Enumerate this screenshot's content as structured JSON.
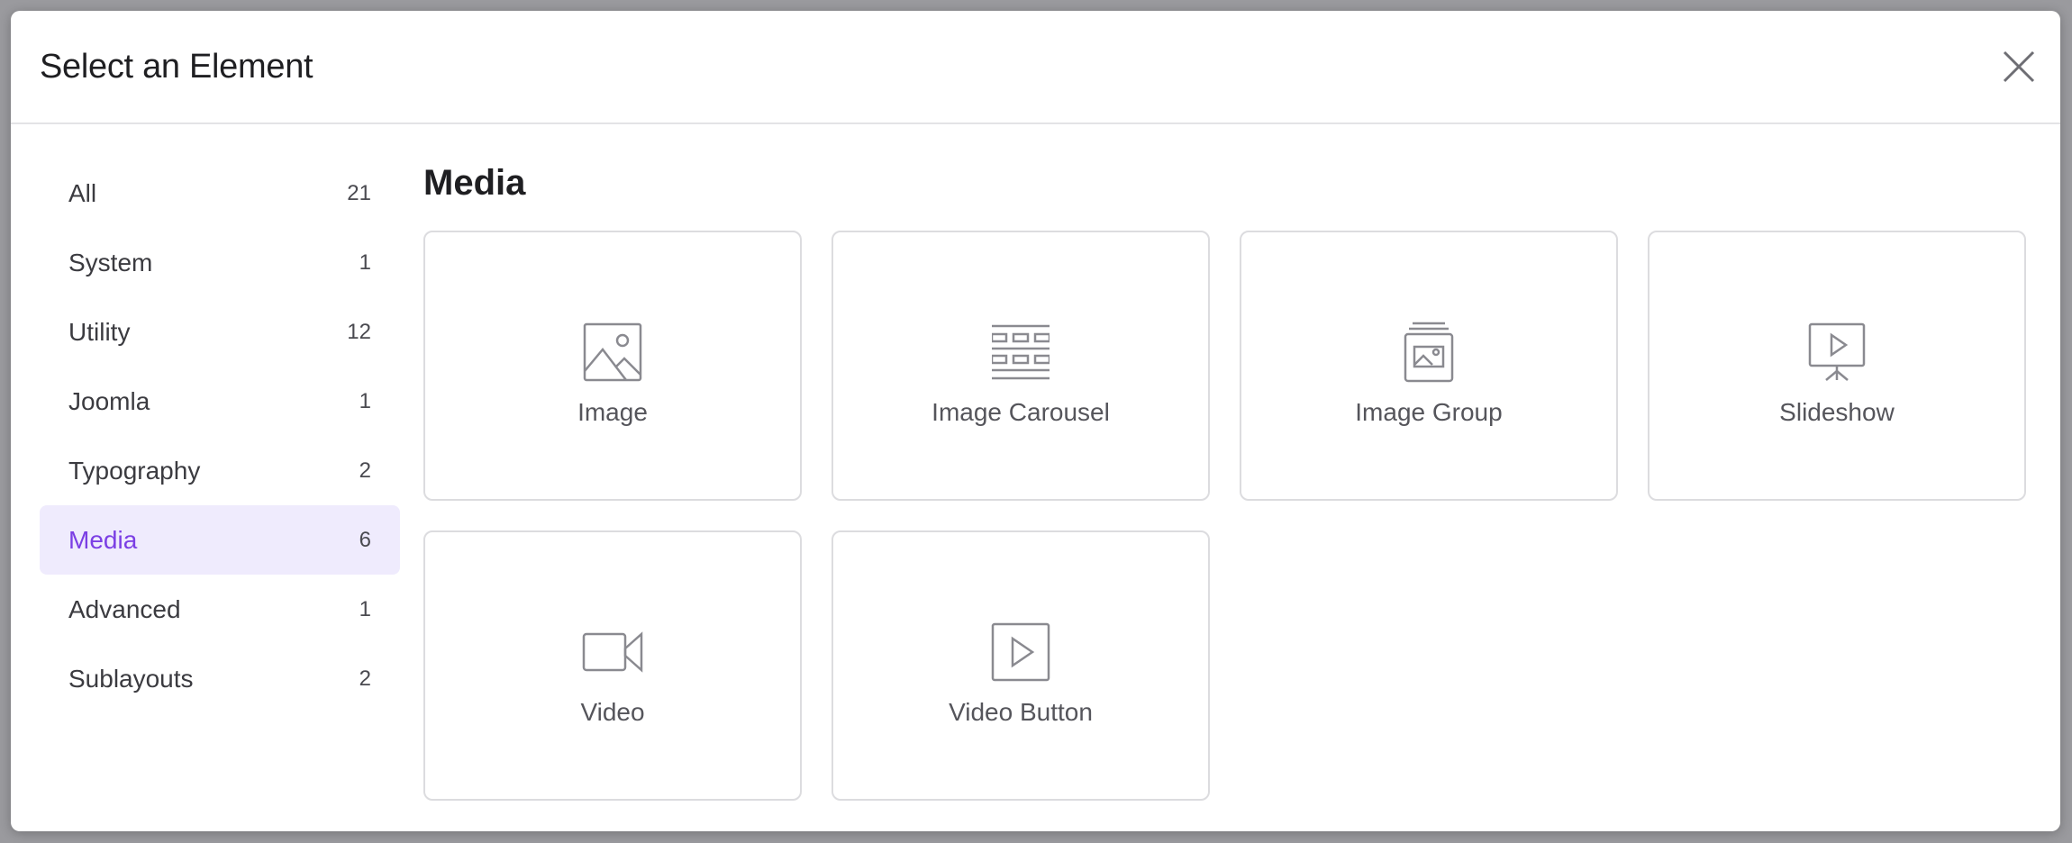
{
  "modal": {
    "title": "Select an Element"
  },
  "sidebar": {
    "categories": [
      {
        "label": "All",
        "count": "21"
      },
      {
        "label": "System",
        "count": "1"
      },
      {
        "label": "Utility",
        "count": "12"
      },
      {
        "label": "Joomla",
        "count": "1"
      },
      {
        "label": "Typography",
        "count": "2"
      },
      {
        "label": "Media",
        "count": "6",
        "active": true
      },
      {
        "label": "Advanced",
        "count": "1"
      },
      {
        "label": "Sublayouts",
        "count": "2"
      }
    ]
  },
  "main": {
    "section_title": "Media",
    "elements": [
      {
        "label": "Image",
        "icon": "image-icon"
      },
      {
        "label": "Image Carousel",
        "icon": "carousel-icon"
      },
      {
        "label": "Image Group",
        "icon": "image-group-icon"
      },
      {
        "label": "Slideshow",
        "icon": "slideshow-icon"
      },
      {
        "label": "Video",
        "icon": "video-camera-icon"
      },
      {
        "label": "Video Button",
        "icon": "play-button-icon"
      }
    ]
  },
  "colors": {
    "accent": "#7b3fe4",
    "active_bg": "#efebfd",
    "card_border": "#dcdcdf",
    "icon_stroke": "#8a8a90"
  }
}
